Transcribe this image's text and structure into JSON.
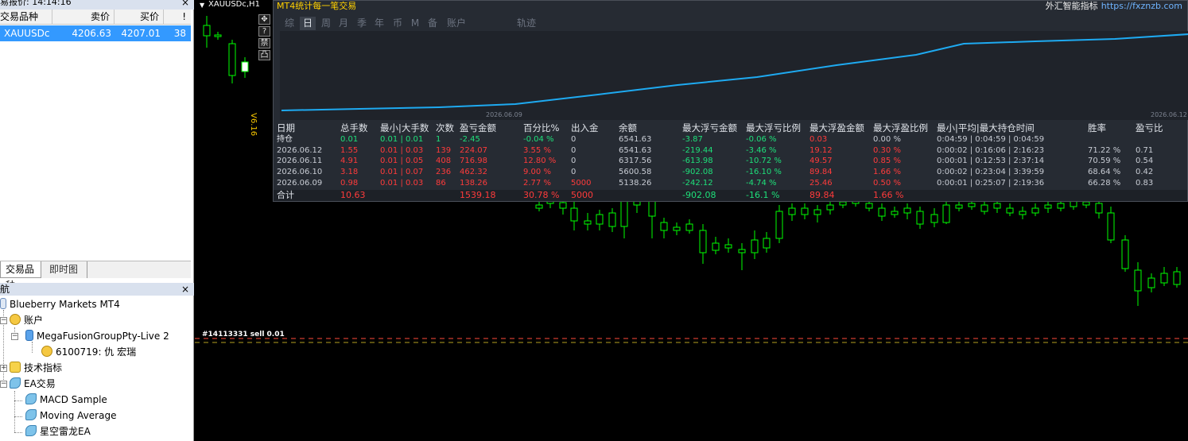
{
  "market_watch": {
    "title": "易报价: 14:14:16",
    "columns": [
      "交易品种",
      "卖价",
      "买价",
      "!"
    ],
    "rows": [
      {
        "symbol": "XAUUSDc",
        "bid": "4206.63",
        "ask": "4207.01",
        "spread": "38"
      }
    ],
    "tabs": [
      "交易品种",
      "即时图"
    ]
  },
  "navigator": {
    "title": "航",
    "items": [
      {
        "label": "Blueberry Markets MT4",
        "icon": "terminal-icon"
      },
      {
        "label": "账户",
        "icon": "accounts-icon"
      },
      {
        "label": "MegaFusionGroupPty-Live 2",
        "icon": "server-icon"
      },
      {
        "label": "6100719: 仇 宏瑞",
        "icon": "user-icon"
      },
      {
        "label": "技术指标",
        "icon": "indicator-icon"
      },
      {
        "label": "EA交易",
        "icon": "expert-icon"
      },
      {
        "label": "MACD Sample",
        "icon": "expert-icon"
      },
      {
        "label": "Moving Average",
        "icon": "expert-icon"
      },
      {
        "label": "星空雷龙EA",
        "icon": "expert-icon"
      }
    ]
  },
  "chart": {
    "title": "XAUUSDc,H1",
    "trade_label": "#14113331 sell 0.01",
    "version": "V6.16",
    "side_tools": [
      "✥",
      "?",
      "禁",
      "凸"
    ],
    "colors": {
      "bull": "#ffffff",
      "bear": "#000000",
      "wick": "#00ff00"
    }
  },
  "panel": {
    "title": "MT4统计每一笔交易",
    "brand": "外汇智能指标",
    "url": "https://fxznzb.com",
    "tabs": [
      "综",
      "日",
      "周",
      "月",
      "季",
      "年",
      "币",
      "M",
      "备",
      "账户",
      "轨迹"
    ],
    "active_tab": "日",
    "equity_axis": {
      "start": "2026.06.09",
      "end": "2026.06.12"
    },
    "headers": [
      "日期",
      "总手数",
      "最小|大手数",
      "次数",
      "盈亏金额",
      "百分比%",
      "出入金",
      "余额",
      "最大浮亏金额",
      "最大浮亏比例",
      "最大浮盈金额",
      "最大浮盈比例",
      "最小|平均|最大持仓时间",
      "胜率",
      "盈亏比"
    ],
    "rows": [
      [
        "持仓",
        "0.01",
        "0.01 | 0.01",
        "1",
        "-2.45",
        "-0.04 %",
        "0",
        "6541.63",
        "-3.87",
        "-0.06 %",
        "0.03",
        "0.00 %",
        "0:04:59 | 0:04:59 | 0:04:59",
        "",
        ""
      ],
      [
        "2026.06.12",
        "1.55",
        "0.01 | 0.03",
        "139",
        "224.07",
        "3.55 %",
        "0",
        "6541.63",
        "-219.44",
        "-3.46 %",
        "19.12",
        "0.30 %",
        "0:00:02 | 0:16:06 | 2:16:23",
        "71.22 %",
        "0.71"
      ],
      [
        "2026.06.11",
        "4.91",
        "0.01 | 0.05",
        "408",
        "716.98",
        "12.80 %",
        "0",
        "6317.56",
        "-613.98",
        "-10.72 %",
        "49.57",
        "0.85 %",
        "0:00:01 | 0:12:53 | 2:37:14",
        "70.59 %",
        "0.54"
      ],
      [
        "2026.06.10",
        "3.18",
        "0.01 | 0.07",
        "236",
        "462.32",
        "9.00 %",
        "0",
        "5600.58",
        "-902.08",
        "-16.10 %",
        "89.84",
        "1.66 %",
        "0:00:02 | 0:23:04 | 3:39:59",
        "68.64 %",
        "0.42"
      ],
      [
        "2026.06.09",
        "0.98",
        "0.01 | 0.03",
        "86",
        "138.26",
        "2.77 %",
        "5000",
        "5138.26",
        "-242.12",
        "-4.74 %",
        "25.46",
        "0.50 %",
        "0:00:01 | 0:25:07 | 2:19:36",
        "66.28 %",
        "0.83"
      ]
    ],
    "total": [
      "合计",
      "10.63",
      "",
      "",
      "1539.18",
      "30.78 %",
      "5000",
      "",
      "-902.08",
      "-16.1 %",
      "89.84",
      "1.66 %",
      "",
      "",
      ""
    ],
    "colors": {
      "header": "#e0e4ea",
      "date": "#c8ccd4",
      "loss": "#ff3b3b",
      "profit": "#1ee07a",
      "neutral": "#c8ccd4",
      "line": "#1eaaf1",
      "gold": "#ffd000"
    }
  }
}
